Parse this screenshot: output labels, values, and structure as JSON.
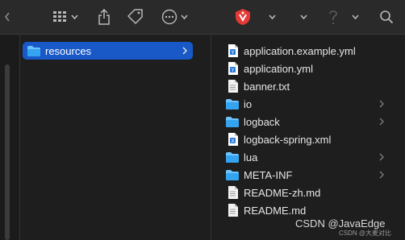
{
  "toolbar": {
    "icons": [
      "grid-view-icon",
      "share-icon",
      "tag-icon",
      "more-actions-icon",
      "app-shield-icon",
      "help-icon",
      "search-icon"
    ]
  },
  "column1": {
    "selected": {
      "label": "resources",
      "icon": "folder-icon"
    }
  },
  "column2": {
    "items": [
      {
        "label": "application.example.yml",
        "icon": "yml-file-icon",
        "folder": false
      },
      {
        "label": "application.yml",
        "icon": "yml-file-icon",
        "folder": false
      },
      {
        "label": "banner.txt",
        "icon": "text-file-icon",
        "folder": false
      },
      {
        "label": "io",
        "icon": "folder-icon",
        "folder": true
      },
      {
        "label": "logback",
        "icon": "folder-icon",
        "folder": true
      },
      {
        "label": "logback-spring.xml",
        "icon": "xml-file-icon",
        "folder": false
      },
      {
        "label": "lua",
        "icon": "folder-icon",
        "folder": true
      },
      {
        "label": "META-INF",
        "icon": "folder-icon",
        "folder": true
      },
      {
        "label": "README-zh.md",
        "icon": "text-file-icon",
        "folder": false
      },
      {
        "label": "README.md",
        "icon": "text-file-icon",
        "folder": false
      }
    ]
  },
  "watermark": {
    "main": "CSDN @JavaEdge",
    "small": "CSDN @大麦对比"
  },
  "colors": {
    "selection": "#1958c7",
    "folder": "#35a4f0",
    "accent_red": "#e53935"
  }
}
